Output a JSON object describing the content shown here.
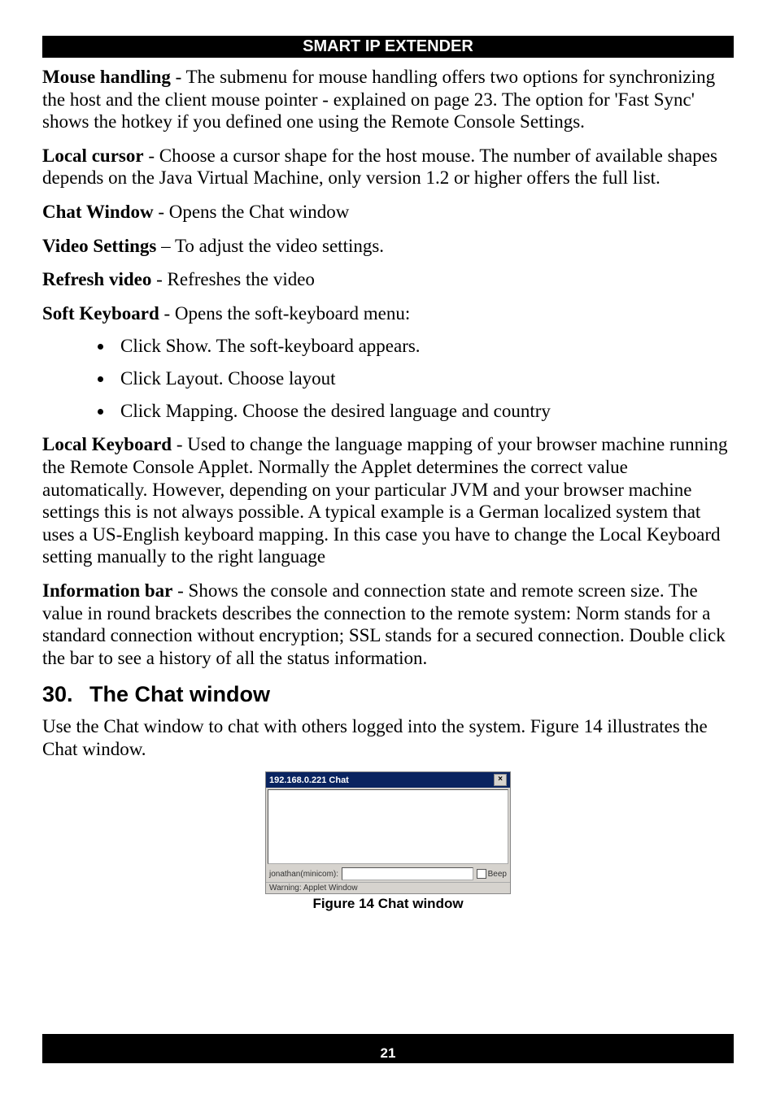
{
  "header": {
    "title": "SMART IP EXTENDER"
  },
  "para1": {
    "term": "Mouse handling",
    "text": " - The submenu for mouse handling offers two options for synchronizing the host and the client mouse pointer - explained on page 23. The option for 'Fast Sync' shows the hotkey if you defined one using the Remote Console Settings."
  },
  "para2": {
    "term": "Local cursor",
    "text": " - Choose a cursor shape for the host mouse. The number of available shapes depends on the Java Virtual Machine, only version 1.2 or higher offers the full list."
  },
  "para3": {
    "term": "Chat Window",
    "text": " - Opens the Chat window"
  },
  "para4": {
    "term": "Video Settings",
    "text": " – To adjust the video settings."
  },
  "para5": {
    "term": "Refresh video",
    "text": " - Refreshes the video"
  },
  "para6": {
    "term": "Soft Keyboard",
    "text": " - Opens the soft-keyboard menu:"
  },
  "bullets": {
    "b1": "Click Show. The soft-keyboard appears.",
    "b2": "Click Layout. Choose layout",
    "b3": "Click Mapping. Choose the desired language and country"
  },
  "para7": {
    "term": "Local Keyboard",
    "text": " - Used to change the language mapping of your browser machine running the Remote Console Applet. Normally the Applet determines the correct value automatically. However, depending on your particular JVM and your browser machine settings this is not always possible. A typical example is a German localized system that uses a US-English keyboard mapping. In this case you have to change the Local Keyboard setting manually to the right language"
  },
  "para8": {
    "term": "Information bar",
    "text": " - Shows the console and connection state and remote screen size. The value in round brackets describes the connection to the remote system: Norm stands for a standard connection without encryption; SSL stands for a secured connection. Double click the bar to see a history of all the status information."
  },
  "section": {
    "num": "30.",
    "title": "The Chat window"
  },
  "para9": "Use the Chat window to chat with others logged into the system. Figure 14 illustrates the Chat window.",
  "chat": {
    "title": "192.168.0.221 Chat",
    "close": "×",
    "user": "jonathan(minicom):",
    "beep": "Beep",
    "status": "Warning: Applet Window"
  },
  "caption": "Figure 14 Chat window",
  "footer": {
    "page": "21"
  }
}
